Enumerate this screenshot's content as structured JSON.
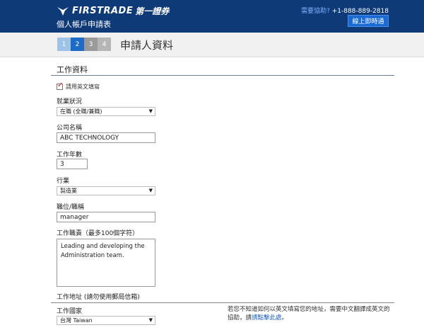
{
  "header": {
    "logo_en": "FIRSTRADE",
    "logo_zh": "第一證券",
    "app_title": "個人帳戶申請表",
    "help_question": "需要協助?",
    "help_phone": "+1-888-889-2818",
    "chat_button": "線上即時通"
  },
  "steps": {
    "items": [
      "1",
      "2",
      "3",
      "4"
    ],
    "active_index": 1,
    "title": "申請人資料"
  },
  "section": {
    "title": "工作資料",
    "english_note": "請用英文填寫"
  },
  "fields": {
    "employment_status": {
      "label": "就業狀況",
      "value": "在職 (全職/兼職)"
    },
    "company_name": {
      "label": "公司名稱",
      "value": "ABC TECHNOLOGY"
    },
    "years_employed": {
      "label": "工作年數",
      "value": "3"
    },
    "industry": {
      "label": "行業",
      "value": "製造業"
    },
    "job_title": {
      "label": "職位/職稱",
      "value": "manager"
    },
    "job_duties": {
      "label": "工作職責（最多100個字符）",
      "value": "Leading and developing the Administration team."
    },
    "work_address": {
      "label": "工作地址 (請勿使用郵局信箱)"
    },
    "work_country": {
      "label": "工作國家",
      "value": "台灣 Taiwan"
    }
  },
  "note": {
    "text": "若您不知道如何以英文填寫您的地址，需要中文翻譯成英文的協助，請",
    "link": "請點擊此處",
    "end": "。"
  },
  "colors": {
    "header_bg": "#0e3a78",
    "step_active": "#1d6bc4",
    "checkbox_check": "#cc2222"
  }
}
